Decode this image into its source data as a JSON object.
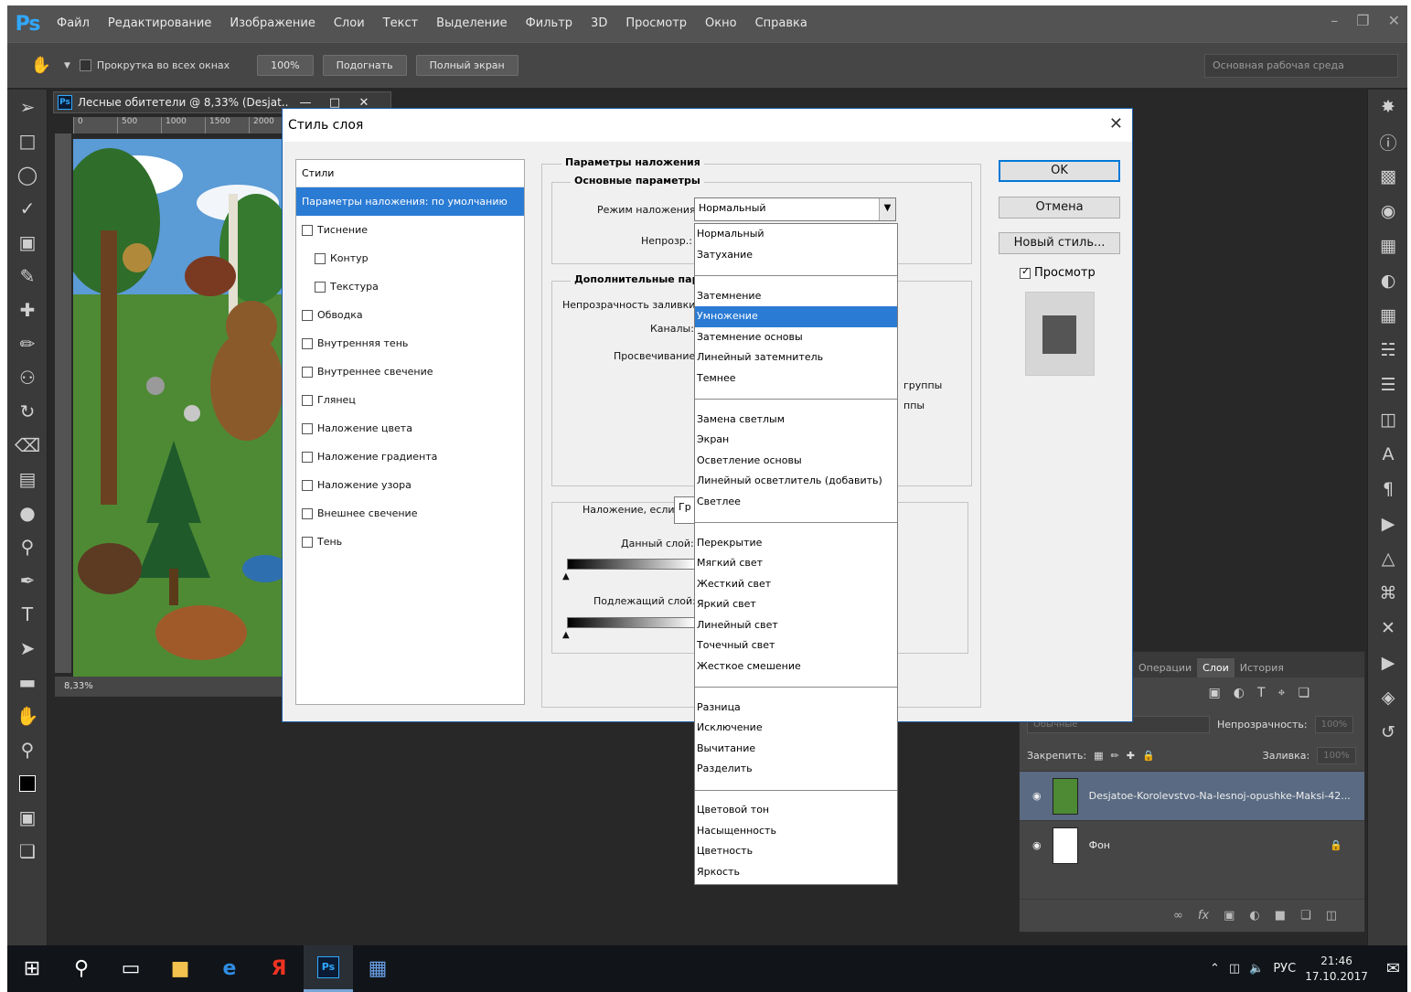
{
  "menubar": {
    "logo": "Ps",
    "items": [
      "Файл",
      "Редактирование",
      "Изображение",
      "Слои",
      "Текст",
      "Выделение",
      "Фильтр",
      "3D",
      "Просмотр",
      "Окно",
      "Справка"
    ]
  },
  "options_bar": {
    "scroll_all_label": "Прокрутка во всех окнах",
    "zoom_100": "100%",
    "fit_label": "Подогнать",
    "fullscreen_label": "Полный экран",
    "workspace": "Основная рабочая среда"
  },
  "document": {
    "title": "Лесные обитетели @ 8,33% (Desjat...",
    "ruler_ticks": [
      "0",
      "500",
      "1000",
      "1500",
      "2000"
    ],
    "zoom_status": "8,33%"
  },
  "dialog": {
    "title": "Стиль слоя",
    "styles_header": "Стили",
    "styles": [
      {
        "label": "Параметры наложения: по умолчанию",
        "selected": true,
        "checkbox": false,
        "indent": 0
      },
      {
        "label": "Тиснение",
        "selected": false,
        "checkbox": true,
        "indent": 0
      },
      {
        "label": "Контур",
        "selected": false,
        "checkbox": true,
        "indent": 1
      },
      {
        "label": "Текстура",
        "selected": false,
        "checkbox": true,
        "indent": 1
      },
      {
        "label": "Обводка",
        "selected": false,
        "checkbox": true,
        "indent": 0
      },
      {
        "label": "Внутренняя тень",
        "selected": false,
        "checkbox": true,
        "indent": 0
      },
      {
        "label": "Внутреннее свечение",
        "selected": false,
        "checkbox": true,
        "indent": 0
      },
      {
        "label": "Глянец",
        "selected": false,
        "checkbox": true,
        "indent": 0
      },
      {
        "label": "Наложение цвета",
        "selected": false,
        "checkbox": true,
        "indent": 0
      },
      {
        "label": "Наложение градиента",
        "selected": false,
        "checkbox": true,
        "indent": 0
      },
      {
        "label": "Наложение узора",
        "selected": false,
        "checkbox": true,
        "indent": 0
      },
      {
        "label": "Внешнее свечение",
        "selected": false,
        "checkbox": true,
        "indent": 0
      },
      {
        "label": "Тень",
        "selected": false,
        "checkbox": true,
        "indent": 0
      }
    ],
    "blending_options_title": "Параметры наложения",
    "general_title": "Основные параметры",
    "blend_mode_label": "Режим наложения:",
    "blend_mode_value": "Нормальный",
    "opacity_label": "Непрозр.:",
    "advanced_title": "Дополнительные пар",
    "fill_opacity_label": "Непрозрачность заливки:",
    "channels_label": "Каналы:",
    "knockout_label": "Просвечивание:",
    "groups_text_1": "группы",
    "groups_text_2": "ппы",
    "blend_if_label": "Наложение, если:",
    "blend_if_value": "Гр",
    "this_layer_label": "Данный слой:",
    "underlying_layer_label": "Подлежащий слой:",
    "ok_label": "OK",
    "cancel_label": "Отмена",
    "new_style_label": "Новый стиль...",
    "preview_label": "Просмотр",
    "preview_checked": true,
    "blend_options": [
      "Нормальный",
      "Затухание",
      "",
      "Затемнение",
      "Умножение",
      "Затемнение основы",
      "Линейный затемнитель",
      "Темнее",
      "",
      "Замена светлым",
      "Экран",
      "Осветление основы",
      "Линейный осветлитель (добавить)",
      "Светлее",
      "",
      "Перекрытие",
      "Мягкий свет",
      "Жесткий свет",
      "Яркий свет",
      "Линейный свет",
      "Точечный свет",
      "Жесткое смешение",
      "",
      "Разница",
      "Исключение",
      "Вычитание",
      "Разделить",
      "",
      "Цветовой тон",
      "Насыщенность",
      "Цветность",
      "Яркость"
    ],
    "blend_highlighted": "Умножение"
  },
  "layers_panel": {
    "tabs": [
      "Операции",
      "Слои",
      "История"
    ],
    "active_tab": "Слои",
    "mode_value": "Обычные",
    "opacity_label": "Непрозрачность:",
    "opacity_value": "100%",
    "lock_label": "Закрепить:",
    "fill_label": "Заливка:",
    "fill_value": "100%",
    "layers": [
      {
        "name": "Desjatoe-Korolevstvo-Na-lesnoj-opushke-Maksi-42...",
        "selected": true
      },
      {
        "name": "Фон",
        "selected": false
      }
    ]
  },
  "taskbar": {
    "lang": "РУС",
    "time": "21:46",
    "date": "17.10.2017"
  }
}
